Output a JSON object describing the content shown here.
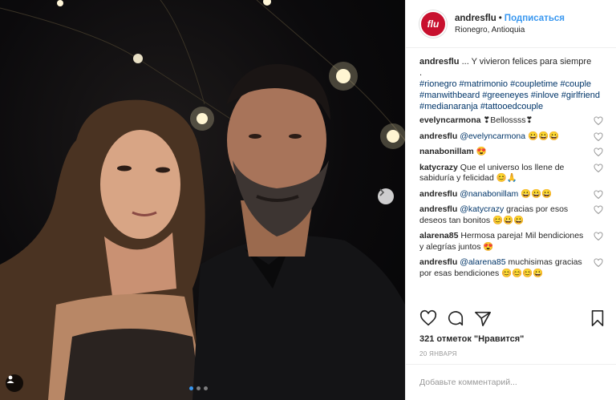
{
  "post": {
    "username": "andresflu",
    "follow_label": "Подписаться",
    "separator": "•",
    "location": "Rionegro, Antioquia",
    "avatar_text": "flu"
  },
  "caption": {
    "username": "andresflu",
    "text": "... Y vivieron felices para siempre",
    "line2": ".",
    "hashtags": "#rionegro #matrimonio #coupletime #couple #manwithbeard #greeneyes #inlove #girlfriend #medianaranja #tattooedcouple"
  },
  "comments": [
    {
      "user": "evelyncarmona",
      "mention": "",
      "text": "❣Bellossss❣"
    },
    {
      "user": "andresflu",
      "mention": "@evelyncarmona",
      "text": "😀😀😀"
    },
    {
      "user": "nanabonillam",
      "mention": "",
      "text": "😍"
    },
    {
      "user": "katycrazy",
      "mention": "",
      "text": "Que el universo los llene de sabiduría y felicidad 😊🙏"
    },
    {
      "user": "andresflu",
      "mention": "@nanabonillam",
      "text": "😀😀😀"
    },
    {
      "user": "andresflu",
      "mention": "@katycrazy",
      "text": "gracias por esos deseos tan bonitos 😊😀😀"
    },
    {
      "user": "alarena85",
      "mention": "",
      "text": "Hermosa pareja! Mil bendiciones y alegrías juntos 😍"
    },
    {
      "user": "andresflu",
      "mention": "@alarena85",
      "text": "muchisimas gracias por esas bendiciones 😊😊😊😀"
    }
  ],
  "icons": {
    "like": "heart-outline-icon",
    "comment": "speech-bubble-icon",
    "share": "share-icon",
    "save": "bookmark-icon",
    "next": "chevron-right-icon",
    "tag": "user-tag-icon"
  },
  "likes": "321 отметок \"Нравится\"",
  "date": "20 ЯНВАРЯ",
  "add_comment_placeholder": "Добавьте комментарий...",
  "carousel": {
    "count": 3,
    "active_index": 0
  },
  "colors": {
    "accent": "#3897f0",
    "avatar": "#c8102e",
    "hashtag": "#003569"
  }
}
